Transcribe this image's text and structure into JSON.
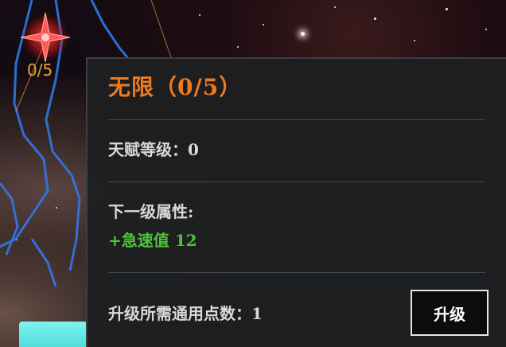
{
  "node": {
    "progress_label": "0/5",
    "current_level": 0,
    "max_level": 5,
    "icon": "red-star-icon"
  },
  "tooltip": {
    "title": "无限（0/5）",
    "talent_level_label": "天赋等级：0",
    "next_level_heading": "下一级属性:",
    "next_level_bonus": "+急速值 12",
    "cost_label": "升级所需通用点数：1",
    "upgrade_button": "升级"
  },
  "colors": {
    "title": "#ee7a1e",
    "bonus": "#4ec23b",
    "node_count": "#e8a23c",
    "constellation_line": "#2f78e8",
    "cyan_button": "#5fe6e4"
  }
}
